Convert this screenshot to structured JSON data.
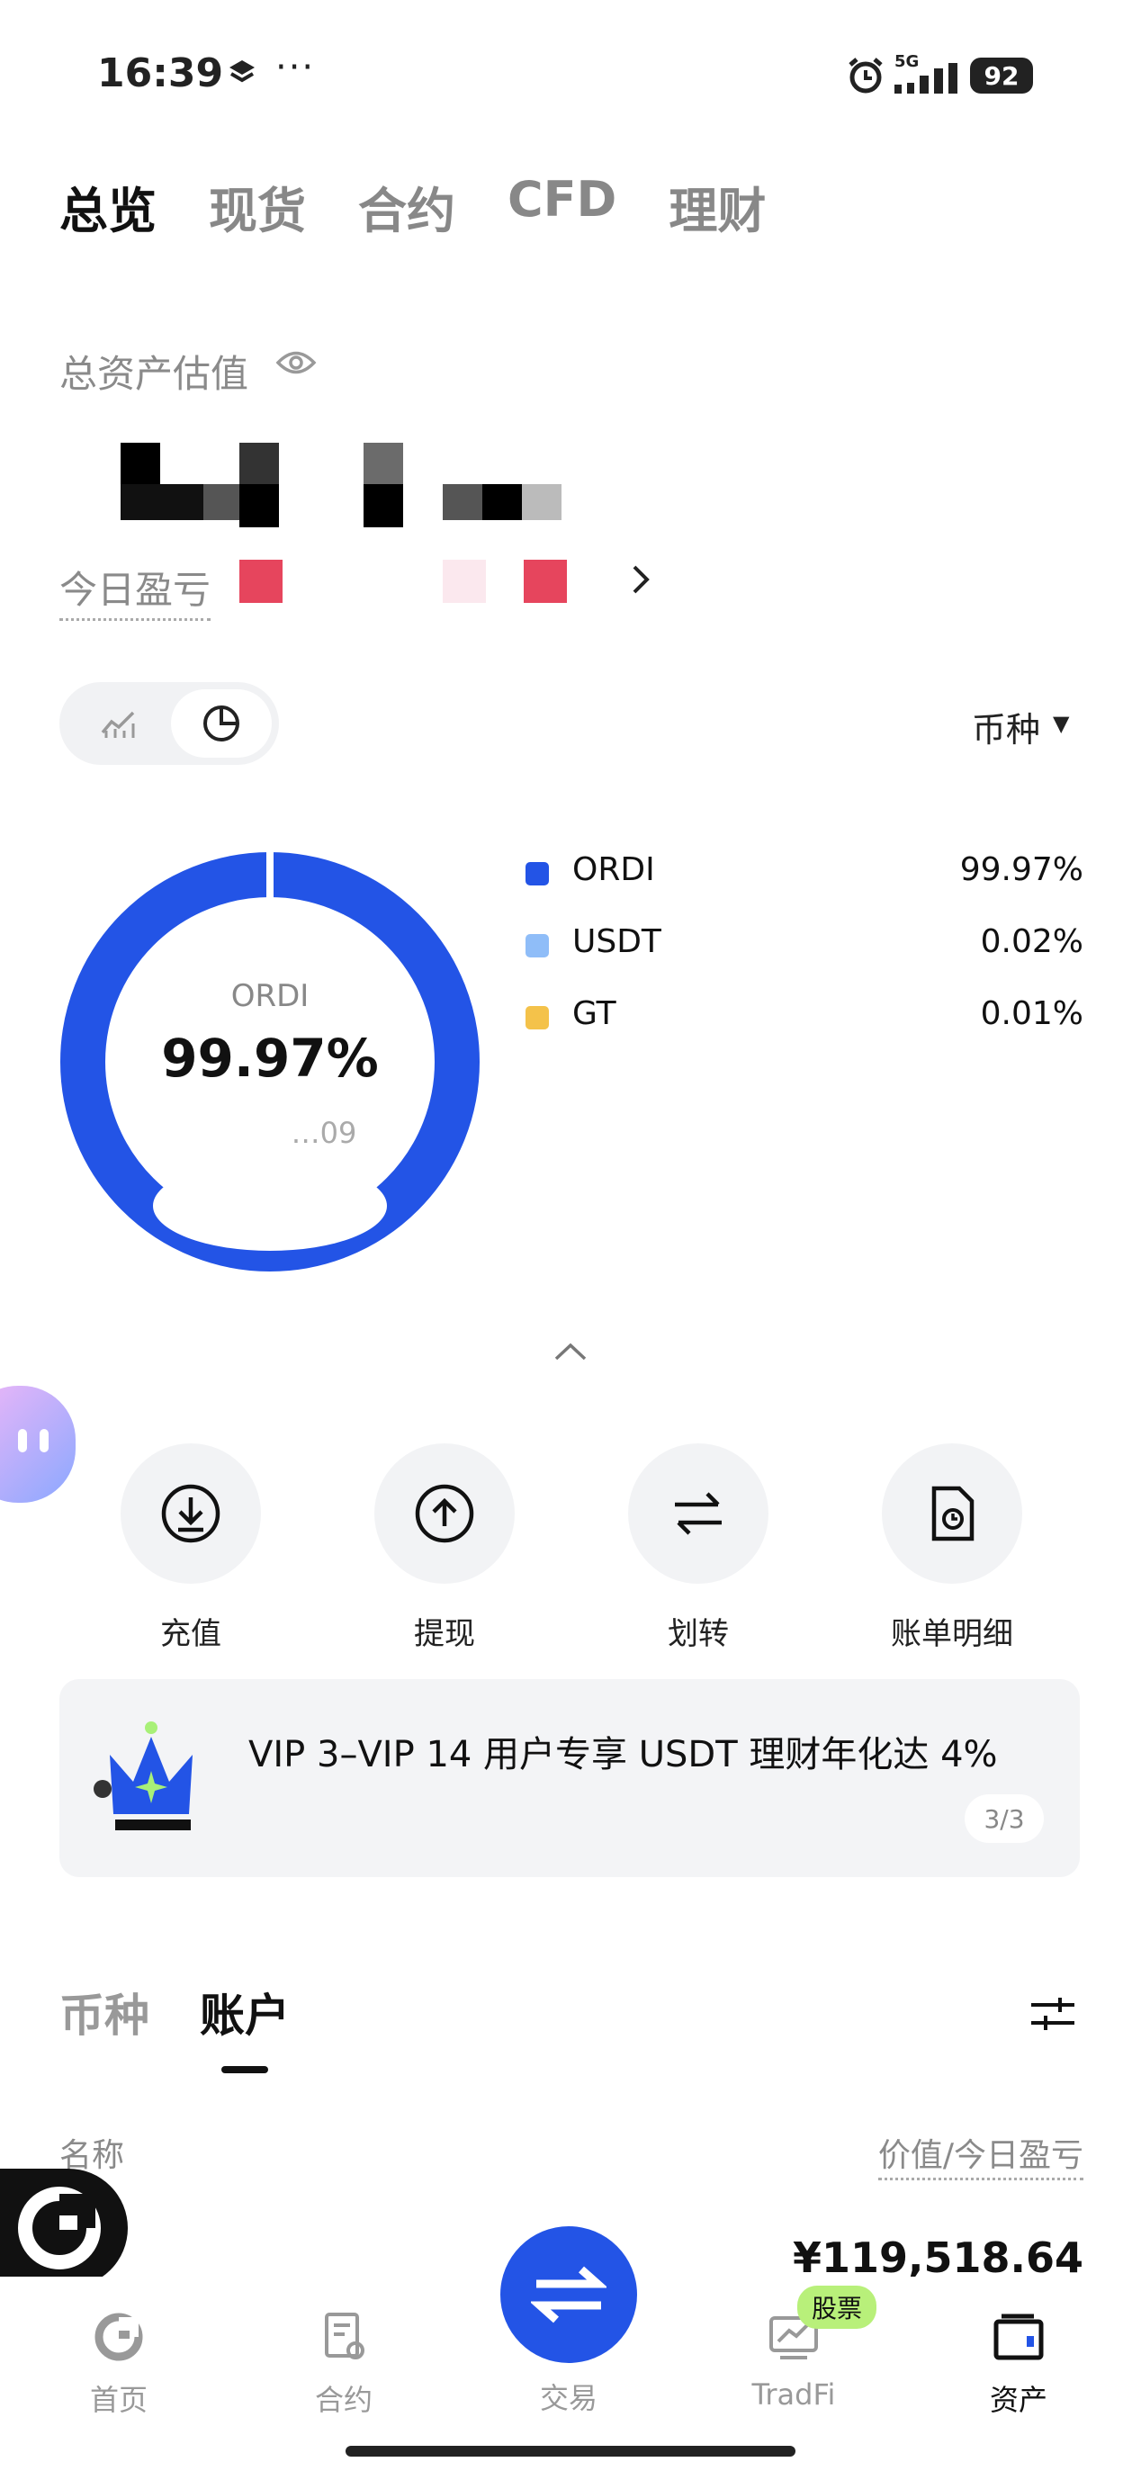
{
  "status_bar": {
    "time": "16:39",
    "dots": "···",
    "network": "5G",
    "battery": "92"
  },
  "top_tabs": [
    "总览",
    "现货",
    "合约",
    "CFD",
    "理财"
  ],
  "total_assets": {
    "label": "总资产估值"
  },
  "today_pnl": {
    "label": "今日盈亏"
  },
  "selector": {
    "label": "币种"
  },
  "donut": {
    "center_label": "ORDI",
    "center_value": "99.97%",
    "center_sub": "…09"
  },
  "allocation": [
    {
      "name": "ORDI",
      "pct": "99.97%",
      "color": "#2354e6"
    },
    {
      "name": "USDT",
      "pct": "0.02%",
      "color": "#8fbdf8"
    },
    {
      "name": "GT",
      "pct": "0.01%",
      "color": "#f4c24a"
    }
  ],
  "actions": [
    {
      "label": "充值",
      "icon": "deposit-icon"
    },
    {
      "label": "提现",
      "icon": "withdraw-icon"
    },
    {
      "label": "划转",
      "icon": "transfer-icon"
    },
    {
      "label": "账单明细",
      "icon": "bill-icon"
    }
  ],
  "promo": {
    "text": "VIP 3–VIP 14 用户专享 USDT 理财年化达 4%",
    "page": "3/3"
  },
  "list_tabs": [
    "币种",
    "账户"
  ],
  "columns": {
    "name": "名称",
    "value": "价值/今日盈亏"
  },
  "first_row": {
    "value": "¥119,518.64"
  },
  "bottom_nav": [
    {
      "label": "首页",
      "icon": "home-icon"
    },
    {
      "label": "合约",
      "icon": "futures-icon"
    },
    {
      "label": "交易",
      "icon": "trade-icon"
    },
    {
      "label": "TradFi",
      "icon": "tradfi-icon",
      "badge": "股票"
    },
    {
      "label": "资产",
      "icon": "assets-icon",
      "active": true
    }
  ]
}
